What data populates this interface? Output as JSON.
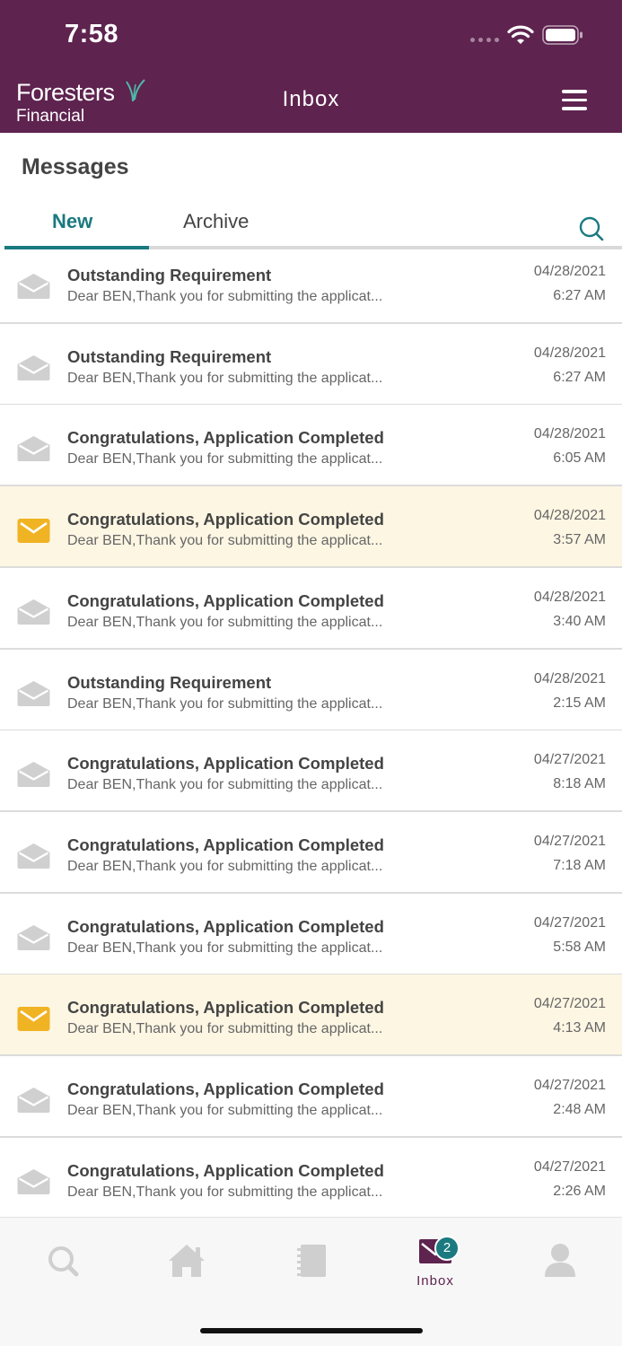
{
  "status_bar": {
    "time": "7:58"
  },
  "header": {
    "logo_line1": "Foresters",
    "logo_line2": "Financial",
    "title": "Inbox",
    "menu_icon": "hamburger-menu-icon"
  },
  "page": {
    "title": "Messages"
  },
  "tabs": {
    "new_label": "New",
    "archive_label": "Archive",
    "active": "New"
  },
  "colors": {
    "brand": "#5e234f",
    "accent": "#1a7a80",
    "unread_bg": "#fdf6e3",
    "unread_icon": "#f0b323",
    "read_icon": "#d0d0d0"
  },
  "messages": [
    {
      "subject": "Outstanding Requirement",
      "preview": "Dear BEN,Thank you for submitting the applicat...",
      "date": "04/28/2021",
      "time": "6:27 AM",
      "unread": false
    },
    {
      "subject": "Outstanding Requirement",
      "preview": "Dear BEN,Thank you for submitting the applicat...",
      "date": "04/28/2021",
      "time": "6:27 AM",
      "unread": false
    },
    {
      "subject": "Congratulations, Application Completed",
      "preview": "Dear BEN,Thank you for submitting the applicat...",
      "date": "04/28/2021",
      "time": "6:05 AM",
      "unread": false
    },
    {
      "subject": "Congratulations, Application Completed",
      "preview": "Dear BEN,Thank you for submitting the applicat...",
      "date": "04/28/2021",
      "time": "3:57 AM",
      "unread": true
    },
    {
      "subject": "Congratulations, Application Completed",
      "preview": "Dear BEN,Thank you for submitting the applicat...",
      "date": "04/28/2021",
      "time": "3:40 AM",
      "unread": false
    },
    {
      "subject": "Outstanding Requirement",
      "preview": "Dear BEN,Thank you for submitting the applicat...",
      "date": "04/28/2021",
      "time": "2:15 AM",
      "unread": false
    },
    {
      "subject": "Congratulations, Application Completed",
      "preview": "Dear BEN,Thank you for submitting the applicat...",
      "date": "04/27/2021",
      "time": "8:18 AM",
      "unread": false
    },
    {
      "subject": "Congratulations, Application Completed",
      "preview": "Dear BEN,Thank you for submitting the applicat...",
      "date": "04/27/2021",
      "time": "7:18 AM",
      "unread": false
    },
    {
      "subject": "Congratulations, Application Completed",
      "preview": "Dear BEN,Thank you for submitting the applicat...",
      "date": "04/27/2021",
      "time": "5:58 AM",
      "unread": false
    },
    {
      "subject": "Congratulations, Application Completed",
      "preview": "Dear BEN,Thank you for submitting the applicat...",
      "date": "04/27/2021",
      "time": "4:13 AM",
      "unread": true
    },
    {
      "subject": "Congratulations, Application Completed",
      "preview": "Dear BEN,Thank you for submitting the applicat...",
      "date": "04/27/2021",
      "time": "2:48 AM",
      "unread": false
    },
    {
      "subject": "Congratulations, Application Completed",
      "preview": "Dear BEN,Thank you for submitting the applicat...",
      "date": "04/27/2021",
      "time": "2:26 AM",
      "unread": false
    }
  ],
  "tabbar": {
    "items": [
      {
        "icon": "search-icon"
      },
      {
        "icon": "home-icon"
      },
      {
        "icon": "notebook-icon"
      },
      {
        "icon": "inbox-icon",
        "label": "Inbox",
        "badge": "2",
        "active": true
      },
      {
        "icon": "profile-icon"
      }
    ]
  }
}
